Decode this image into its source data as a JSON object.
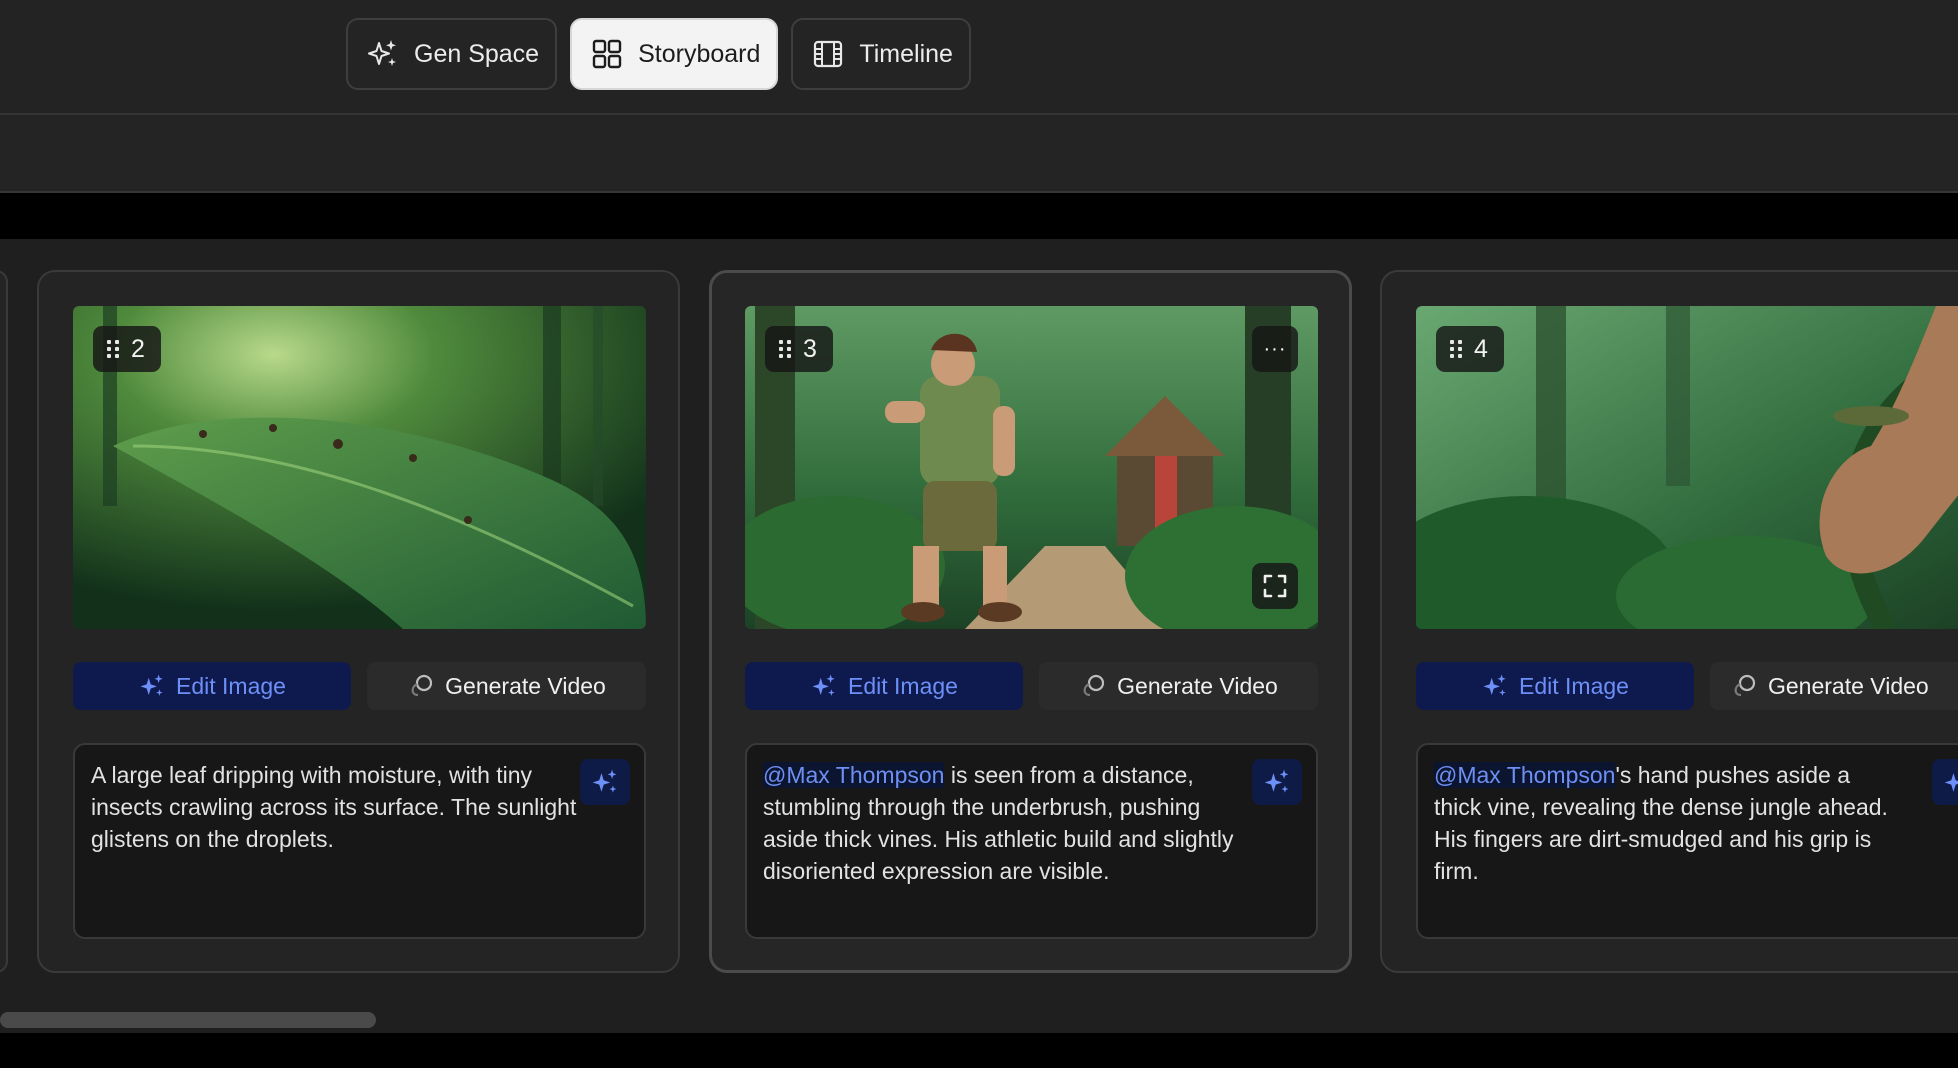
{
  "header": {
    "tabs": [
      {
        "label": "Gen Space",
        "icon": "sparkles-icon",
        "active": false
      },
      {
        "label": "Storyboard",
        "icon": "grid-icon",
        "active": true
      },
      {
        "label": "Timeline",
        "icon": "film-icon",
        "active": false
      }
    ]
  },
  "board": {
    "cards": [
      {
        "number": "2",
        "edit_label": "Edit Image",
        "video_label": "Generate Video",
        "prompt": "A large leaf dripping with moisture, with tiny insects crawling across its surface. The sunlight glistens on the droplets."
      },
      {
        "number": "3",
        "edit_label": "Edit Image",
        "video_label": "Generate Video",
        "mention": "@Max Thompson",
        "prompt_rest": " is seen from a distance, stumbling through the underbrush, pushing aside thick vines. His athletic build and slightly disoriented expression are visible.",
        "more_label": "···"
      },
      {
        "number": "4",
        "edit_label": "Edit Image",
        "video_label": "Generate Video",
        "mention": "@Max Thompson",
        "prompt_rest": "'s hand pushes aside a thick vine, revealing the dense jungle ahead. His fingers are dirt-smudged and his grip is firm."
      }
    ]
  },
  "colors": {
    "accent_blue": "#6d8ff7",
    "edit_button_bg": "#0e1a4d",
    "panel": "#242424"
  }
}
